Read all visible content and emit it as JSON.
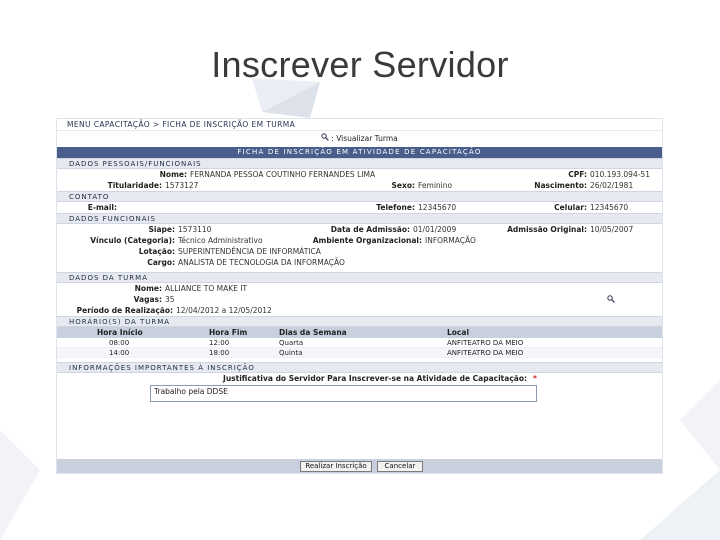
{
  "slide": {
    "title": "Inscrever Servidor"
  },
  "breadcrumb": {
    "text": "Menu Capacitação > Ficha de Inscrição em Turma"
  },
  "toolbar": {
    "visualizar_label": ": Visualizar Turma"
  },
  "form": {
    "header": "Ficha de Inscrição em Atividade de Capacitação"
  },
  "sections": {
    "pessoais": "Dados Pessoais/Funcionais",
    "contato": "Contato",
    "funcionais": "Dados Funcionais",
    "turma": "Dados da Turma",
    "horarios": "Horário(s) da Turma",
    "info": "Informações Importantes à Inscrição"
  },
  "personal": {
    "nome_label": "Nome:",
    "nome_value": "FERNANDA PESSOA COUTINHO FERNANDES LIMA",
    "cpf_label": "CPF:",
    "cpf_value": "010.193.094-51",
    "titularidade_label": "Titularidade:",
    "titularidade_value": "1573127",
    "sexo_label": "Sexo:",
    "sexo_value": "Feminino",
    "nascimento_label": "Nascimento:",
    "nascimento_value": "26/02/1981"
  },
  "contact": {
    "email_label": "E-mail:",
    "email_value": "",
    "telefone_label": "Telefone:",
    "telefone_value": "12345670",
    "celular_label": "Celular:",
    "celular_value": "12345670"
  },
  "functional": {
    "siape_label": "Siape:",
    "siape_value": "1573110",
    "admissao_label": "Data de Admissão:",
    "admissao_value": "01/01/2009",
    "admissao_orig_label": "Admissão Original:",
    "admissao_orig_value": "10/05/2007",
    "vinculo_label": "Vínculo (Categoria):",
    "vinculo_value": "Técnico Administrativo",
    "ambiente_label": "Ambiente Organizacional:",
    "ambiente_value": "INFORMAÇÃO",
    "lotacao_label": "Lotação:",
    "lotacao_value": "SUPERINTENDÊNCIA DE INFORMÁTICA",
    "cargo_label": "Cargo:",
    "cargo_value": "ANALISTA DE TECNOLOGIA DA INFORMAÇÃO"
  },
  "turma": {
    "nome_label": "Nome:",
    "nome_value": "ALLIANCE TO MAKE IT",
    "vagas_label": "Vagas:",
    "vagas_value": "35",
    "periodo_label": "Período de Realização:",
    "periodo_value": "12/04/2012 a 12/05/2012"
  },
  "schedule": {
    "headers": [
      "Hora Início",
      "Hora Fim",
      "Dias da Semana",
      "Local"
    ],
    "rows": [
      {
        "inicio": "08:00",
        "fim": "12:00",
        "dia": "Quarta",
        "local": "ANFITEATRO DA MEIO"
      },
      {
        "inicio": "14:00",
        "fim": "18:00",
        "dia": "Quinta",
        "local": "ANFITEATRO DA MEIO"
      }
    ]
  },
  "justificativa": {
    "label": "Justificativa do Servidor Para Inscrever-se na Atividade de Capacitação:",
    "required_mark": "*",
    "value": "Trabalho pela DDSE"
  },
  "buttons": {
    "submit": "Realizar Inscrição",
    "cancel": "Cancelar"
  },
  "colors": {
    "header_bg": "#4a5e8c",
    "section_bg": "#e6e9f0",
    "button_bar": "#c8d0de",
    "required": "#d02020"
  }
}
